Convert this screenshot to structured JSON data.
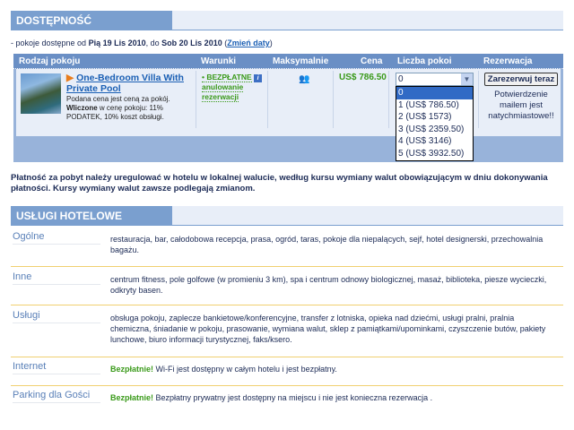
{
  "availability": {
    "title": "DOSTĘPNOŚĆ",
    "prefix": "- pokoje dostępne od",
    "from": "Pią 19 Lis 2010",
    "mid": ", do",
    "to": "Sob 20 Lis 2010",
    "change_dates": "Zmień daty"
  },
  "table": {
    "headers": [
      "Rodzaj pokoju",
      "Warunki",
      "Maksymalnie",
      "Cena",
      "Liczba pokoi",
      "Rezerwacja"
    ],
    "room": {
      "name": "One-Bedroom Villa With Private Pool",
      "desc1": "Podana cena jest ceną za pokój.",
      "desc_bold": "Wliczone",
      "desc2": " w cenę pokoju: 11% PODATEK, 10% koszt obsługi.",
      "condition_prefix": "• BEZPŁATNE",
      "condition": "anulowanie rezerwacji",
      "price": "US$ 786.50",
      "selected": "0",
      "options": [
        "0",
        "1 (US$ 786.50)",
        "2 (US$ 1573)",
        "3 (US$ 2359.50)",
        "4 (US$ 3146)",
        "5 (US$ 3932.50)"
      ],
      "book": "Zarezerwuj teraz",
      "confirm": "Potwierdzenie mailem jest natychmiastowe!!"
    }
  },
  "payment_note": "Płatność za pobyt należy uregulować w hotelu w lokalnej walucie, według kursu wymiany walut obowiązującym w dniu dokonywania płatności. Kursy wymiany walut zawsze podlegają zmianom.",
  "facilities": {
    "title": "USŁUGI HOTELOWE",
    "free": "Bezpłatnie!",
    "rows": [
      {
        "label": "Ogólne",
        "text": "restauracja, bar, całodobowa recepcja, prasa, ogród, taras, pokoje dla niepalących, sejf, hotel designerski, przechowalnia bagażu."
      },
      {
        "label": "Inne",
        "text": "centrum fitness, pole golfowe (w promieniu 3 km), spa i centrum odnowy biologicznej, masaż, biblioteka, piesze wycieczki, odkryty basen."
      },
      {
        "label": "Usługi",
        "text": "obsługa pokoju, zaplecze bankietowe/konferencyjne, transfer z lotniska, opieka nad dziećmi, usługi pralni, pralnia chemiczna, śniadanie w pokoju, prasowanie, wymiana walut, sklep z pamiątkami/upominkami, czyszczenie butów, pakiety lunchowe, biuro informacji turystycznej, faks/ksero."
      },
      {
        "label": "Internet",
        "text": " Wi-Fi jest dostępny w całym hotelu i jest bezpłatny."
      },
      {
        "label": "Parking dla Gości",
        "text": " Bezpłatny prywatny jest dostępny na miejscu i nie jest konieczna rezerwacja ."
      }
    ]
  }
}
